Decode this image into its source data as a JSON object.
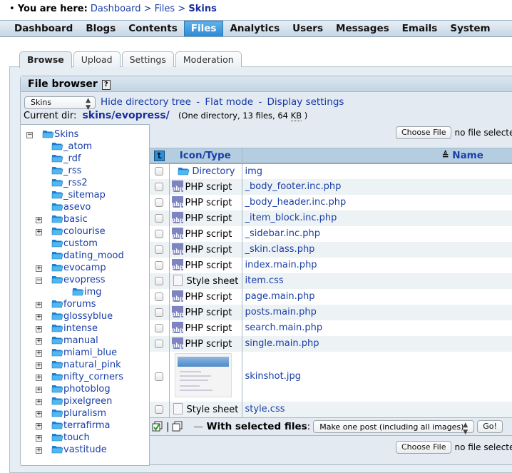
{
  "breadcrumb": {
    "lead": "You are here:",
    "items": [
      "Dashboard",
      "Files"
    ],
    "current": "Skins",
    "separator": ">"
  },
  "topmenu": {
    "items": [
      "Dashboard",
      "Blogs",
      "Contents",
      "Files",
      "Analytics",
      "Users",
      "Messages",
      "Emails",
      "System"
    ],
    "active": "Files"
  },
  "tabs": {
    "items": [
      "Browse",
      "Upload",
      "Settings",
      "Moderation"
    ],
    "active": "Browse"
  },
  "file_browser": {
    "title": "File browser",
    "help_icon": "?",
    "root_select": "Skins",
    "links": [
      "Hide directory tree",
      "Flat mode",
      "Display settings"
    ],
    "link_separator": "-",
    "current_dir_label": "Current dir:",
    "current_dir_parts": [
      "skins",
      "evopress"
    ],
    "dir_info_pre": "(One directory, 13 files, 64 ",
    "dir_info_unit": "KB",
    "dir_info_post": " )"
  },
  "tree": {
    "root": "Skins",
    "items": [
      {
        "label": "_atom",
        "toggle": ""
      },
      {
        "label": "_rdf",
        "toggle": ""
      },
      {
        "label": "_rss",
        "toggle": ""
      },
      {
        "label": "_rss2",
        "toggle": ""
      },
      {
        "label": "_sitemap",
        "toggle": ""
      },
      {
        "label": "asevo",
        "toggle": ""
      },
      {
        "label": "basic",
        "toggle": "+"
      },
      {
        "label": "colourise",
        "toggle": "+"
      },
      {
        "label": "custom",
        "toggle": ""
      },
      {
        "label": "dating_mood",
        "toggle": ""
      },
      {
        "label": "evocamp",
        "toggle": "+"
      },
      {
        "label": "evopress",
        "toggle": "-"
      },
      {
        "label": "img",
        "toggle": "",
        "child": true
      },
      {
        "label": "forums",
        "toggle": "+"
      },
      {
        "label": "glossyblue",
        "toggle": "+"
      },
      {
        "label": "intense",
        "toggle": "+"
      },
      {
        "label": "manual",
        "toggle": "+"
      },
      {
        "label": "miami_blue",
        "toggle": "+"
      },
      {
        "label": "natural_pink",
        "toggle": "+"
      },
      {
        "label": "nifty_corners",
        "toggle": "+"
      },
      {
        "label": "photoblog",
        "toggle": "+"
      },
      {
        "label": "pixelgreen",
        "toggle": "+"
      },
      {
        "label": "pluralism",
        "toggle": "+"
      },
      {
        "label": "terrafirma",
        "toggle": "+"
      },
      {
        "label": "touch",
        "toggle": "+"
      },
      {
        "label": "vastitude",
        "toggle": "+"
      }
    ]
  },
  "upload": {
    "choose_file": "Choose File",
    "no_file": "no file selected"
  },
  "table": {
    "col_type": "Icon/Type",
    "col_name": "Name",
    "sort_indicator": "≜",
    "rows": [
      {
        "type": "Directory",
        "icon": "folder",
        "name": "img"
      },
      {
        "type": "PHP script",
        "icon": "php",
        "name": "_body_footer.inc.php"
      },
      {
        "type": "PHP script",
        "icon": "php",
        "name": "_body_header.inc.php"
      },
      {
        "type": "PHP script",
        "icon": "php",
        "name": "_item_block.inc.php"
      },
      {
        "type": "PHP script",
        "icon": "php",
        "name": "_sidebar.inc.php"
      },
      {
        "type": "PHP script",
        "icon": "php",
        "name": "_skin.class.php"
      },
      {
        "type": "PHP script",
        "icon": "php",
        "name": "index.main.php"
      },
      {
        "type": "Style sheet",
        "icon": "css",
        "name": "item.css"
      },
      {
        "type": "PHP script",
        "icon": "php",
        "name": "page.main.php"
      },
      {
        "type": "PHP script",
        "icon": "php",
        "name": "posts.main.php"
      },
      {
        "type": "PHP script",
        "icon": "php",
        "name": "search.main.php"
      },
      {
        "type": "PHP script",
        "icon": "php",
        "name": "single.main.php"
      },
      {
        "type": "",
        "icon": "thumbnail",
        "name": "skinshot.jpg"
      },
      {
        "type": "Style sheet",
        "icon": "css",
        "name": "style.css"
      }
    ]
  },
  "bulk": {
    "separator": "|",
    "dash": "—",
    "label": "With selected files",
    "colon": ":",
    "action": "Make one post (including all images)",
    "go": "Go!"
  },
  "colors": {
    "link": "#1a3fa7",
    "menu_active": "#2c8bd4",
    "folder": "#2a9de8",
    "table_header": "#b5cde0",
    "panel": "#e3eaf1"
  }
}
